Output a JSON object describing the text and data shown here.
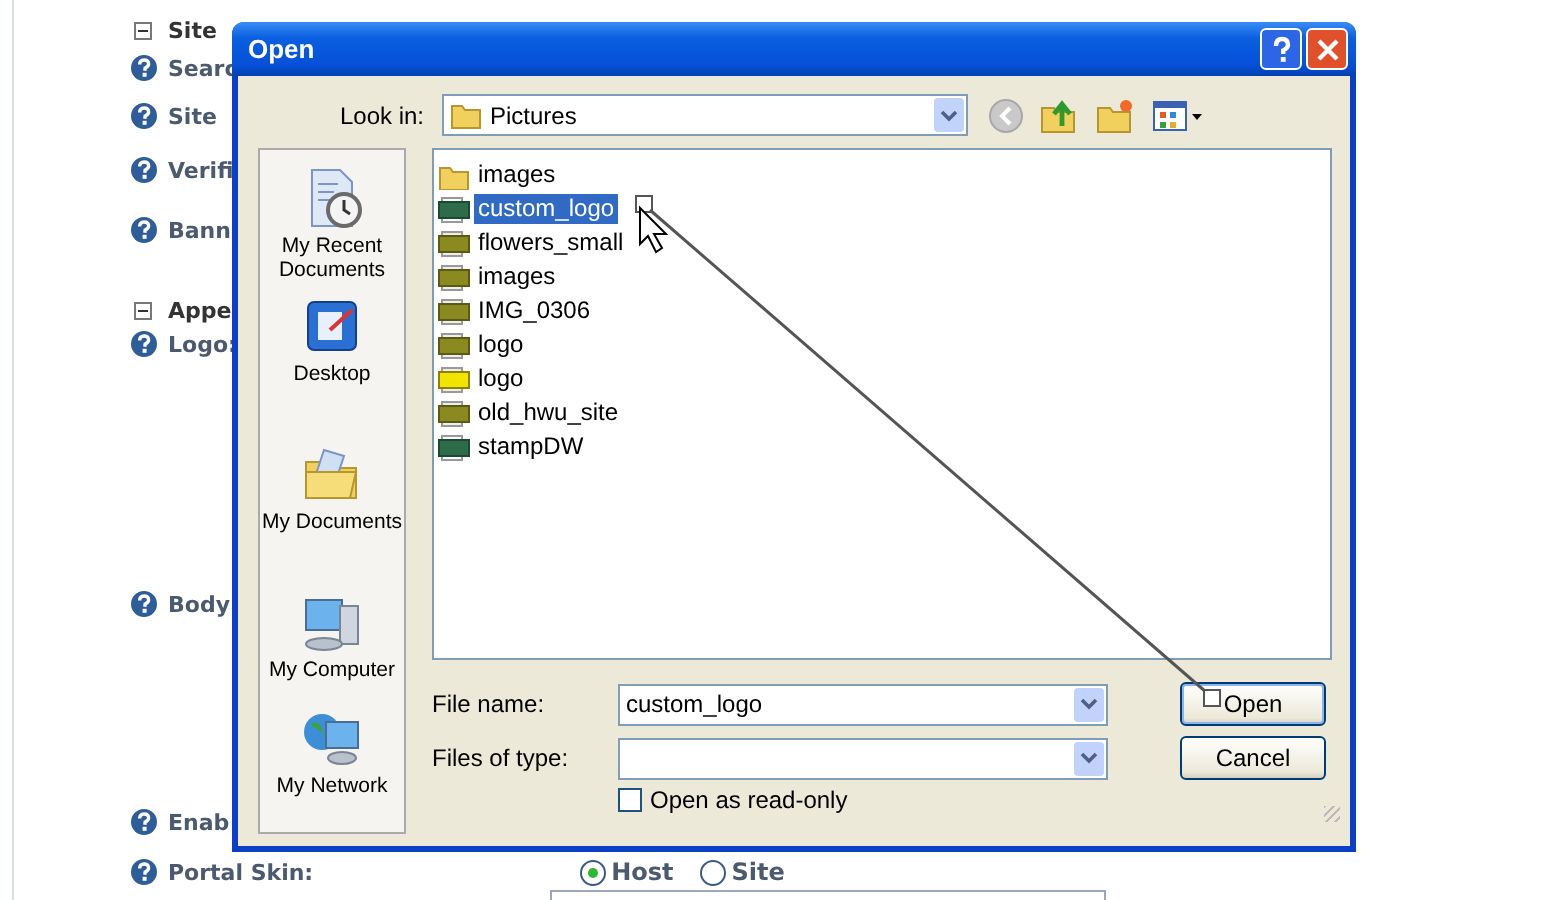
{
  "background_page": {
    "rows": [
      {
        "kind": "section",
        "label": "Site"
      },
      {
        "kind": "field",
        "label": "Searc"
      },
      {
        "kind": "field",
        "label": "Site"
      },
      {
        "kind": "field",
        "label": "Verifi"
      },
      {
        "kind": "field",
        "label": "Bann"
      },
      {
        "kind": "section",
        "label": "Appe"
      },
      {
        "kind": "field",
        "label": "Logo:"
      },
      {
        "kind": "field",
        "label": "Body"
      },
      {
        "kind": "field",
        "label": "Enab"
      },
      {
        "kind": "field",
        "label": "Portal Skin:"
      }
    ],
    "skin_options": [
      {
        "label": "Host",
        "selected": true
      },
      {
        "label": "Site",
        "selected": false
      }
    ]
  },
  "dialog": {
    "title": "Open",
    "look_in": {
      "label": "Look in:",
      "value": "Pictures"
    },
    "places": [
      {
        "kind": "recent",
        "label": "My Recent Documents"
      },
      {
        "kind": "desktop",
        "label": "Desktop"
      },
      {
        "kind": "documents",
        "label": "My Documents"
      },
      {
        "kind": "computer",
        "label": "My Computer"
      },
      {
        "kind": "network",
        "label": "My Network"
      }
    ],
    "files": [
      {
        "kind": "folder",
        "name": "images",
        "selected": false
      },
      {
        "kind": "gif",
        "name": "custom_logo",
        "selected": true
      },
      {
        "kind": "jpg",
        "name": "flowers_small",
        "selected": false
      },
      {
        "kind": "jpg",
        "name": "images",
        "selected": false
      },
      {
        "kind": "jpg",
        "name": "IMG_0306",
        "selected": false
      },
      {
        "kind": "jpg",
        "name": "logo",
        "selected": false
      },
      {
        "kind": "psd",
        "name": "logo",
        "selected": false
      },
      {
        "kind": "jpg",
        "name": "old_hwu_site",
        "selected": false
      },
      {
        "kind": "gif",
        "name": "stampDW",
        "selected": false
      }
    ],
    "file_name": {
      "label": "File name:",
      "value": "custom_logo"
    },
    "file_type": {
      "label": "Files of type:"
    },
    "read_only": {
      "label": "Open as read-only",
      "checked": false
    },
    "buttons": [
      {
        "label": "Open",
        "default": true
      },
      {
        "label": "Cancel",
        "default": false
      }
    ]
  }
}
